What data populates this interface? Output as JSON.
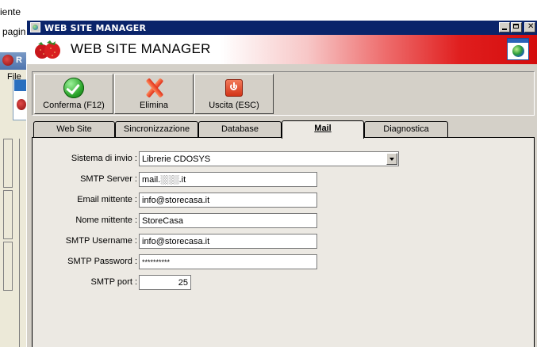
{
  "background": {
    "text_top": "iente",
    "text_side": "pagin",
    "window_title_letter": "R",
    "menu_file": "File"
  },
  "window": {
    "title": "WEB SITE MANAGER",
    "banner_title": "WEB SITE MANAGER"
  },
  "toolbar": {
    "confirm_label": "Conferma (F12)",
    "delete_label": "Elimina",
    "exit_label": "Uscita (ESC)"
  },
  "tabs": [
    {
      "label": "Web Site"
    },
    {
      "label": "Sincronizzazione"
    },
    {
      "label": "Database"
    },
    {
      "label": "Mail",
      "active": true
    },
    {
      "label": "Diagnostica"
    }
  ],
  "mail_form": {
    "send_system_label": "Sistema di invio :",
    "send_system_value": "Librerie CDOSYS",
    "smtp_server_label": "SMTP Server :",
    "smtp_server_value": "mail.░░░.it",
    "sender_email_label": "Email mittente :",
    "sender_email_value": "info@storecasa.it",
    "sender_name_label": "Nome mittente :",
    "sender_name_value": "StoreCasa",
    "smtp_username_label": "SMTP Username :",
    "smtp_username_value": "info@storecasa.it",
    "smtp_password_label": "SMTP Password :",
    "smtp_password_value": "**********",
    "smtp_port_label": "SMTP port :",
    "smtp_port_value": "25"
  }
}
